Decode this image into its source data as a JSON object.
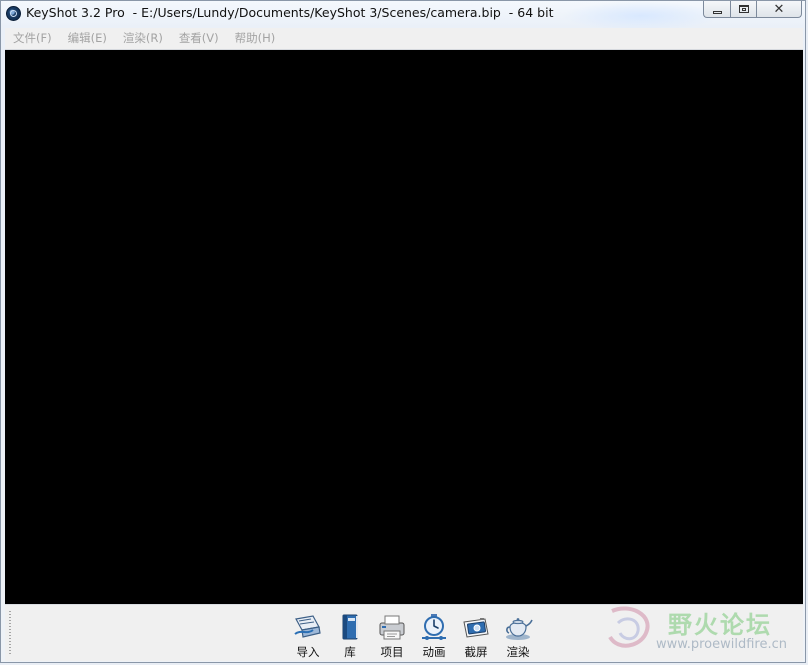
{
  "window": {
    "title": "KeyShot 3.2 Pro  - E:/Users/Lundy/Documents/KeyShot 3/Scenes/camera.bip  - 64 bit",
    "caption": {
      "minimize_icon": "minimize-icon",
      "maximize_icon": "restore-icon",
      "close_icon": "close-icon",
      "close_glyph": "✕"
    }
  },
  "menubar": {
    "items": [
      {
        "label": "文件(F)"
      },
      {
        "label": "编辑(E)"
      },
      {
        "label": "渲染(R)"
      },
      {
        "label": "查看(V)"
      },
      {
        "label": "帮助(H)"
      }
    ]
  },
  "viewport": {
    "background": "#000000"
  },
  "toolbar": {
    "tools": [
      {
        "label": "导入",
        "icon": "import-icon"
      },
      {
        "label": "库",
        "icon": "library-icon"
      },
      {
        "label": "项目",
        "icon": "project-icon"
      },
      {
        "label": "动画",
        "icon": "animation-icon"
      },
      {
        "label": "截屏",
        "icon": "screenshot-icon"
      },
      {
        "label": "渲染",
        "icon": "render-teapot-icon"
      }
    ]
  },
  "watermark": {
    "text": "野火论坛",
    "url": "www.proewildfire.cn"
  }
}
